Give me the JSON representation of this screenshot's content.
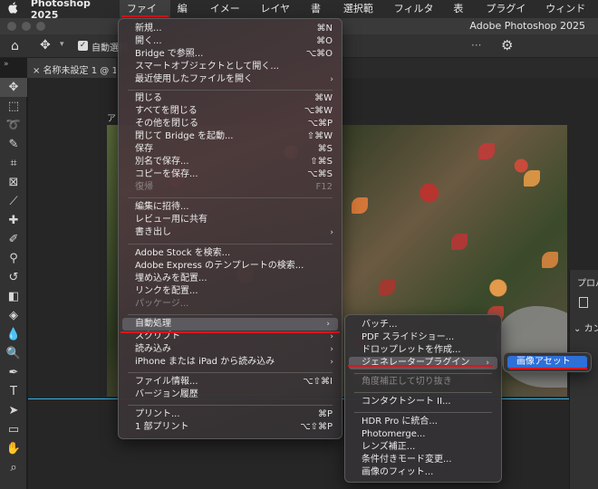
{
  "menubar": {
    "apple": "",
    "app": "Photoshop 2025",
    "items": [
      "ファイル",
      "編集",
      "イメージ",
      "レイヤー",
      "書式",
      "選択範囲",
      "フィルター",
      "表示",
      "プラグイン",
      "ウィンドウ"
    ]
  },
  "window": {
    "title": "Adobe Photoshop 2025"
  },
  "optionsbar": {
    "auto_select": "自動選択"
  },
  "doc_tab": {
    "label": "名称未設定 1 @ 10"
  },
  "canvas_label": "ア",
  "right_panel": {
    "title": "プロパ",
    "section": "カン"
  },
  "file_menu": {
    "items": [
      {
        "label": "新規...",
        "shortcut": "⌘N"
      },
      {
        "label": "開く...",
        "shortcut": "⌘O"
      },
      {
        "label": "Bridge で参照...",
        "shortcut": "⌥⌘O"
      },
      {
        "label": "スマートオブジェクトとして開く...",
        "shortcut": ""
      },
      {
        "label": "最近使用したファイルを開く",
        "shortcut": "",
        "submenu": true
      },
      {
        "label": "閉じる",
        "shortcut": "⌘W"
      },
      {
        "label": "すべてを閉じる",
        "shortcut": "⌥⌘W"
      },
      {
        "label": "その他を閉じる",
        "shortcut": "⌥⌘P"
      },
      {
        "label": "閉じて Bridge を起動...",
        "shortcut": "⇧⌘W"
      },
      {
        "label": "保存",
        "shortcut": "⌘S"
      },
      {
        "label": "別名で保存...",
        "shortcut": "⇧⌘S"
      },
      {
        "label": "コピーを保存...",
        "shortcut": "⌥⌘S"
      },
      {
        "label": "復帰",
        "shortcut": "F12",
        "disabled": true
      },
      {
        "label": "編集に招待...",
        "shortcut": ""
      },
      {
        "label": "レビュー用に共有",
        "shortcut": ""
      },
      {
        "label": "書き出し",
        "shortcut": "",
        "submenu": true
      },
      {
        "label": "Adobe Stock を検索...",
        "shortcut": ""
      },
      {
        "label": "Adobe Express のテンプレートの検索...",
        "shortcut": ""
      },
      {
        "label": "埋め込みを配置...",
        "shortcut": ""
      },
      {
        "label": "リンクを配置...",
        "shortcut": ""
      },
      {
        "label": "パッケージ...",
        "shortcut": "",
        "disabled": true
      },
      {
        "label": "自動処理",
        "shortcut": "",
        "submenu": true,
        "highlighted": true
      },
      {
        "label": "スクリプト",
        "shortcut": "",
        "submenu": true
      },
      {
        "label": "読み込み",
        "shortcut": "",
        "submenu": true
      },
      {
        "label": "iPhone または iPad から読み込み",
        "shortcut": "",
        "submenu": true
      },
      {
        "label": "ファイル情報...",
        "shortcut": "⌥⇧⌘I"
      },
      {
        "label": "バージョン履歴",
        "shortcut": ""
      },
      {
        "label": "プリント...",
        "shortcut": "⌘P"
      },
      {
        "label": "1 部プリント",
        "shortcut": "⌥⇧⌘P"
      }
    ]
  },
  "automate_menu": {
    "items": [
      {
        "label": "バッチ..."
      },
      {
        "label": "PDF スライドショー..."
      },
      {
        "label": "ドロップレットを作成..."
      },
      {
        "label": "ジェネレータープラグイン",
        "submenu": true,
        "highlighted": true
      },
      {
        "label": "角度補正して切り抜き",
        "disabled": true
      },
      {
        "label": "コンタクトシート II..."
      },
      {
        "label": "HDR Pro に統合..."
      },
      {
        "label": "Photomerge..."
      },
      {
        "label": "レンズ補正..."
      },
      {
        "label": "条件付きモード変更..."
      },
      {
        "label": "画像のフィット..."
      }
    ]
  },
  "generator_menu": {
    "items": [
      {
        "label": "画像アセット"
      }
    ]
  },
  "colors": {
    "accent_red": "#e0141b",
    "selection_blue": "#2e6fd8",
    "guide_cyan": "#3ab0e0"
  }
}
